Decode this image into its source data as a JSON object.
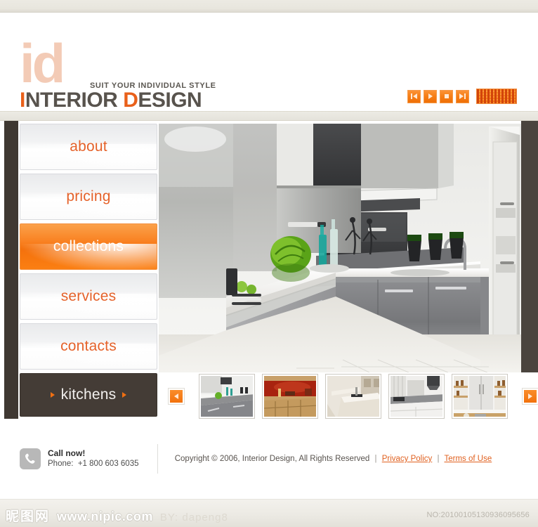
{
  "site": {
    "logo_mark": "id",
    "logo_tagline": "SUIT YOUR INDIVIDUAL STYLE",
    "logo_word_1": "I",
    "logo_word_2": "NTERIOR ",
    "logo_word_3": "D",
    "logo_word_4": "ESIGN",
    "accent_orange": "#f1700c",
    "accent_dark": "#443c36",
    "logo_peach": "#f3cbb6"
  },
  "media_controls": {
    "previous_label": "previous-track",
    "play_label": "play",
    "stop_label": "stop",
    "next_label": "next-track",
    "equalizer_label": "equalizer-display"
  },
  "nav": {
    "items": [
      {
        "label": "about",
        "active": false,
        "dark": false
      },
      {
        "label": "pricing",
        "active": false,
        "dark": false
      },
      {
        "label": "collections",
        "active": true,
        "dark": false
      },
      {
        "label": "services",
        "active": false,
        "dark": false
      },
      {
        "label": "contacts",
        "active": false,
        "dark": false
      },
      {
        "label": "kitchens",
        "active": false,
        "dark": true
      }
    ]
  },
  "gallery": {
    "hero_alt": "modern grey gloss kitchen with island and extractor hood",
    "prev_label": "previous-thumbnails",
    "next_label": "next-thumbnails",
    "thumbnails": [
      {
        "alt": "grey gloss kitchen with green cabbage"
      },
      {
        "alt": "wooden kitchen with red splashback"
      },
      {
        "alt": "beige kitchen island with hob"
      },
      {
        "alt": "white kitchen with grey worktop"
      },
      {
        "alt": "white kitchen with fridge and shelving"
      }
    ]
  },
  "footer": {
    "call_title": "Call now!",
    "phone_label": "Phone:",
    "phone_number": "+1 800 603 6035",
    "copyright": "Copyright © 2006, Interior Design, All Rights Reserved",
    "sep": "|",
    "privacy_link": "Privacy Policy",
    "terms_link": "Terms of Use",
    "phone_icon": "phone-handset-icon"
  },
  "watermark": {
    "site_cn": "昵图网",
    "site_url": "www.nipic.com",
    "author": "BY: dapeng8",
    "id_number": "NO:20100105130936095656"
  }
}
